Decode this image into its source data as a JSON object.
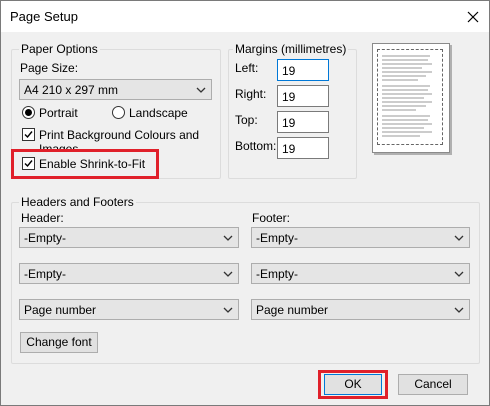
{
  "window": {
    "title": "Page Setup",
    "close_glyph": "✕"
  },
  "paper_options": {
    "legend": "Paper Options",
    "page_size_label": "Page Size:",
    "page_size_value": "A4 210 x 297 mm",
    "portrait_label": "Portrait",
    "landscape_label": "Landscape",
    "orientation_selected": "Portrait",
    "print_background_label_line1": "Print Background Colours and",
    "print_background_label_line2": "Images",
    "print_background_checked": true,
    "shrink_to_fit_label": "Enable Shrink-to-Fit",
    "shrink_to_fit_checked": true
  },
  "margins": {
    "legend": "Margins (millimetres)",
    "left_label": "Left:",
    "left_value": "19",
    "right_label": "Right:",
    "right_value": "19",
    "top_label": "Top:",
    "top_value": "19",
    "bottom_label": "Bottom:",
    "bottom_value": "19"
  },
  "headers_footers": {
    "legend": "Headers and Footers",
    "header_label": "Header:",
    "footer_label": "Footer:",
    "header_values": [
      "-Empty-",
      "-Empty-",
      "Page number"
    ],
    "footer_values": [
      "-Empty-",
      "-Empty-",
      "Page number"
    ],
    "change_font_label": "Change font"
  },
  "buttons": {
    "ok_label": "OK",
    "cancel_label": "Cancel"
  },
  "colors": {
    "highlight": "#e0202a",
    "focus_border": "#0078d7"
  },
  "icons": {
    "close": "close-icon",
    "chevron": "chevron-down-icon",
    "check": "check-icon"
  }
}
